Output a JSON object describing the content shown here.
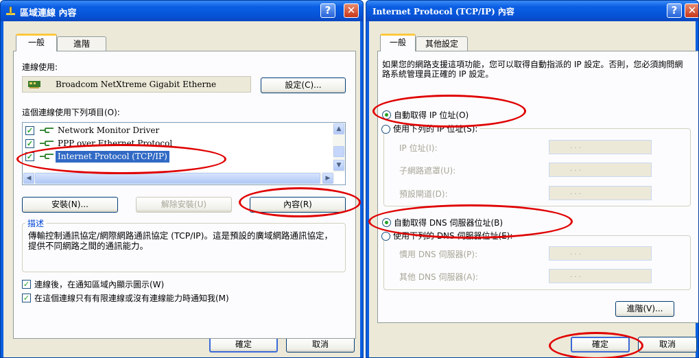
{
  "left_dialog": {
    "title": "區域連線 內容",
    "help_button": "?",
    "close_button": "✕",
    "tabs": [
      {
        "label": "一般"
      },
      {
        "label": "進階"
      }
    ],
    "connect_using_label": "連線使用:",
    "adapter_name": "Broadcom NetXtreme Gigabit Etherne",
    "configure_button": "設定(C)...",
    "items_label": "這個連線使用下列項目(O):",
    "items": [
      {
        "label": "Network Monitor Driver",
        "checked": true
      },
      {
        "label": "PPP over Ethernet Protocol",
        "checked": true
      },
      {
        "label": "Internet Protocol (TCP/IP)",
        "checked": true,
        "selected": true
      }
    ],
    "install_button": "安裝(N)...",
    "uninstall_button": "解除安裝(U)",
    "properties_button": "內容(R)",
    "description_title": "描述",
    "description_text": "傳輸控制通訊協定/網際網路通訊協定 (TCP/IP)。這是預設的廣域網路通訊協定，提供不同網路之間的通訊能力。",
    "show_icon_label": "連線後，在通知區域內顯示圖示(W)",
    "notify_label": "在這個連線只有有限連線或沒有連線能力時通知我(M)",
    "ok_button": "確定",
    "cancel_button": "取消"
  },
  "right_dialog": {
    "title": "Internet Protocol (TCP/IP) 內容",
    "help_button": "?",
    "close_button": "✕",
    "tabs": [
      {
        "label": "一般"
      },
      {
        "label": "其他設定"
      }
    ],
    "intro_text": "如果您的網路支援這項功能，您可以取得自動指派的 IP 設定。否則，您必須詢問網路系統管理員正確的 IP 設定。",
    "auto_ip_label": "自動取得 IP 位址(O)",
    "manual_ip_label": "使用下列的 IP 位址(S):",
    "ip_address_label": "IP 位址(I):",
    "subnet_label": "子網路遮罩(U):",
    "gateway_label": "預設閘道(D):",
    "auto_dns_label": "自動取得 DNS 伺服器位址(B)",
    "manual_dns_label": "使用下列的 DNS 伺服器位址(E):",
    "preferred_dns_label": "慣用 DNS 伺服器(P):",
    "alternate_dns_label": "其他 DNS 伺服器(A):",
    "ip_placeholder": ".   .   .",
    "advanced_button": "進階(V)...",
    "ok_button": "確定",
    "cancel_button": "取消"
  },
  "colors": {
    "title_bar": "#0a5ee0",
    "dialog_bg": "#ece9d8",
    "selection": "#316ac5",
    "annotation": "#e00000",
    "check_green": "#21a121"
  }
}
